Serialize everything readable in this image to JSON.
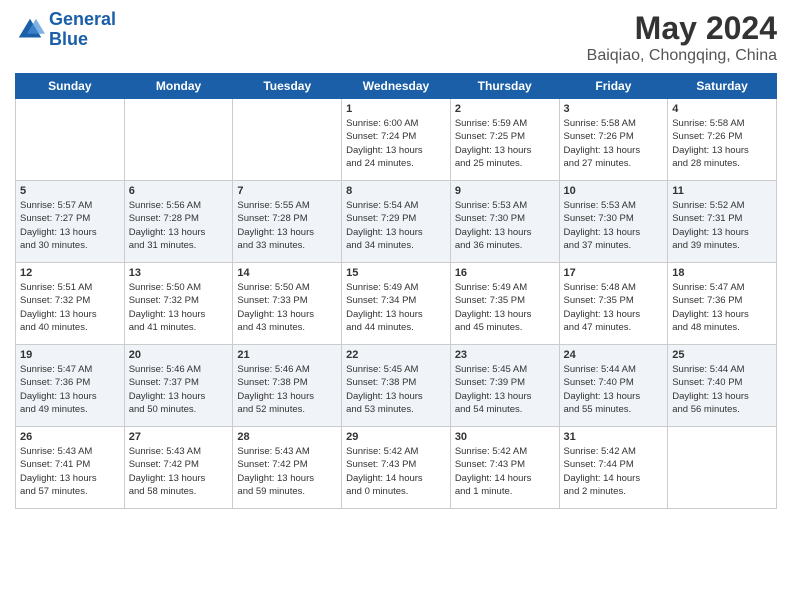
{
  "header": {
    "logo_line1": "General",
    "logo_line2": "Blue",
    "title": "May 2024",
    "subtitle": "Baiqiao, Chongqing, China"
  },
  "weekdays": [
    "Sunday",
    "Monday",
    "Tuesday",
    "Wednesday",
    "Thursday",
    "Friday",
    "Saturday"
  ],
  "weeks": [
    [
      {
        "day": "",
        "info": ""
      },
      {
        "day": "",
        "info": ""
      },
      {
        "day": "",
        "info": ""
      },
      {
        "day": "1",
        "info": "Sunrise: 6:00 AM\nSunset: 7:24 PM\nDaylight: 13 hours\nand 24 minutes."
      },
      {
        "day": "2",
        "info": "Sunrise: 5:59 AM\nSunset: 7:25 PM\nDaylight: 13 hours\nand 25 minutes."
      },
      {
        "day": "3",
        "info": "Sunrise: 5:58 AM\nSunset: 7:26 PM\nDaylight: 13 hours\nand 27 minutes."
      },
      {
        "day": "4",
        "info": "Sunrise: 5:58 AM\nSunset: 7:26 PM\nDaylight: 13 hours\nand 28 minutes."
      }
    ],
    [
      {
        "day": "5",
        "info": "Sunrise: 5:57 AM\nSunset: 7:27 PM\nDaylight: 13 hours\nand 30 minutes."
      },
      {
        "day": "6",
        "info": "Sunrise: 5:56 AM\nSunset: 7:28 PM\nDaylight: 13 hours\nand 31 minutes."
      },
      {
        "day": "7",
        "info": "Sunrise: 5:55 AM\nSunset: 7:28 PM\nDaylight: 13 hours\nand 33 minutes."
      },
      {
        "day": "8",
        "info": "Sunrise: 5:54 AM\nSunset: 7:29 PM\nDaylight: 13 hours\nand 34 minutes."
      },
      {
        "day": "9",
        "info": "Sunrise: 5:53 AM\nSunset: 7:30 PM\nDaylight: 13 hours\nand 36 minutes."
      },
      {
        "day": "10",
        "info": "Sunrise: 5:53 AM\nSunset: 7:30 PM\nDaylight: 13 hours\nand 37 minutes."
      },
      {
        "day": "11",
        "info": "Sunrise: 5:52 AM\nSunset: 7:31 PM\nDaylight: 13 hours\nand 39 minutes."
      }
    ],
    [
      {
        "day": "12",
        "info": "Sunrise: 5:51 AM\nSunset: 7:32 PM\nDaylight: 13 hours\nand 40 minutes."
      },
      {
        "day": "13",
        "info": "Sunrise: 5:50 AM\nSunset: 7:32 PM\nDaylight: 13 hours\nand 41 minutes."
      },
      {
        "day": "14",
        "info": "Sunrise: 5:50 AM\nSunset: 7:33 PM\nDaylight: 13 hours\nand 43 minutes."
      },
      {
        "day": "15",
        "info": "Sunrise: 5:49 AM\nSunset: 7:34 PM\nDaylight: 13 hours\nand 44 minutes."
      },
      {
        "day": "16",
        "info": "Sunrise: 5:49 AM\nSunset: 7:35 PM\nDaylight: 13 hours\nand 45 minutes."
      },
      {
        "day": "17",
        "info": "Sunrise: 5:48 AM\nSunset: 7:35 PM\nDaylight: 13 hours\nand 47 minutes."
      },
      {
        "day": "18",
        "info": "Sunrise: 5:47 AM\nSunset: 7:36 PM\nDaylight: 13 hours\nand 48 minutes."
      }
    ],
    [
      {
        "day": "19",
        "info": "Sunrise: 5:47 AM\nSunset: 7:36 PM\nDaylight: 13 hours\nand 49 minutes."
      },
      {
        "day": "20",
        "info": "Sunrise: 5:46 AM\nSunset: 7:37 PM\nDaylight: 13 hours\nand 50 minutes."
      },
      {
        "day": "21",
        "info": "Sunrise: 5:46 AM\nSunset: 7:38 PM\nDaylight: 13 hours\nand 52 minutes."
      },
      {
        "day": "22",
        "info": "Sunrise: 5:45 AM\nSunset: 7:38 PM\nDaylight: 13 hours\nand 53 minutes."
      },
      {
        "day": "23",
        "info": "Sunrise: 5:45 AM\nSunset: 7:39 PM\nDaylight: 13 hours\nand 54 minutes."
      },
      {
        "day": "24",
        "info": "Sunrise: 5:44 AM\nSunset: 7:40 PM\nDaylight: 13 hours\nand 55 minutes."
      },
      {
        "day": "25",
        "info": "Sunrise: 5:44 AM\nSunset: 7:40 PM\nDaylight: 13 hours\nand 56 minutes."
      }
    ],
    [
      {
        "day": "26",
        "info": "Sunrise: 5:43 AM\nSunset: 7:41 PM\nDaylight: 13 hours\nand 57 minutes."
      },
      {
        "day": "27",
        "info": "Sunrise: 5:43 AM\nSunset: 7:42 PM\nDaylight: 13 hours\nand 58 minutes."
      },
      {
        "day": "28",
        "info": "Sunrise: 5:43 AM\nSunset: 7:42 PM\nDaylight: 13 hours\nand 59 minutes."
      },
      {
        "day": "29",
        "info": "Sunrise: 5:42 AM\nSunset: 7:43 PM\nDaylight: 14 hours\nand 0 minutes."
      },
      {
        "day": "30",
        "info": "Sunrise: 5:42 AM\nSunset: 7:43 PM\nDaylight: 14 hours\nand 1 minute."
      },
      {
        "day": "31",
        "info": "Sunrise: 5:42 AM\nSunset: 7:44 PM\nDaylight: 14 hours\nand 2 minutes."
      },
      {
        "day": "",
        "info": ""
      }
    ]
  ]
}
